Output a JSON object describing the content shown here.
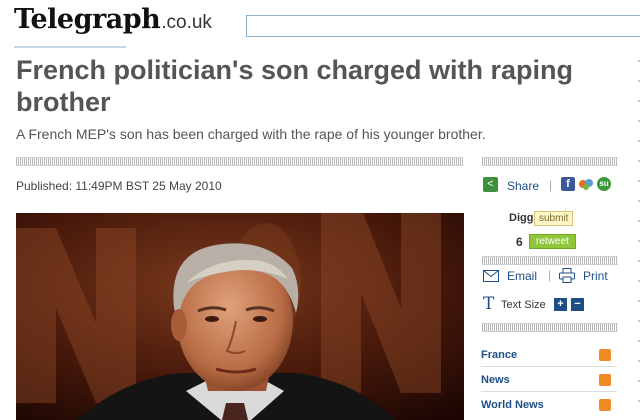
{
  "masthead": {
    "logo_main": "Telegraph",
    "logo_domain": ".co.uk",
    "search_value": ""
  },
  "article": {
    "headline": "French politician's son charged with raping brother",
    "standfirst": "A French MEP's son has been charged with the rape of his younger brother.",
    "published": "Published: 11:49PM BST 25 May 2010",
    "photo_icon": "politician-photo"
  },
  "sidebar": {
    "share_label": "Share",
    "share_separator": "|",
    "digg_label": "Digg",
    "digg_button": "submit",
    "retweet_count": "6",
    "retweet_button": "retweet",
    "email_label": "Email",
    "print_label": "Print",
    "text_size_label": "Text Size",
    "text_size_increase": "+",
    "text_size_decrease": "−",
    "topics": [
      {
        "label": "France"
      },
      {
        "label": "News"
      },
      {
        "label": "World News"
      }
    ]
  },
  "icons": {
    "share": "share-icon",
    "facebook": "facebook-icon",
    "stumble": "social-icon",
    "stumbleupon": "stumbleupon-icon",
    "email": "envelope-icon",
    "print": "printer-icon",
    "text_size": "text-size-icon",
    "rss": "rss-icon"
  },
  "colors": {
    "link_blue": "#1d4f86",
    "headline_grey": "#555555",
    "retweet_green": "#8fc63a",
    "rss_orange": "#f08a24",
    "facebook_blue": "#3b5998"
  }
}
